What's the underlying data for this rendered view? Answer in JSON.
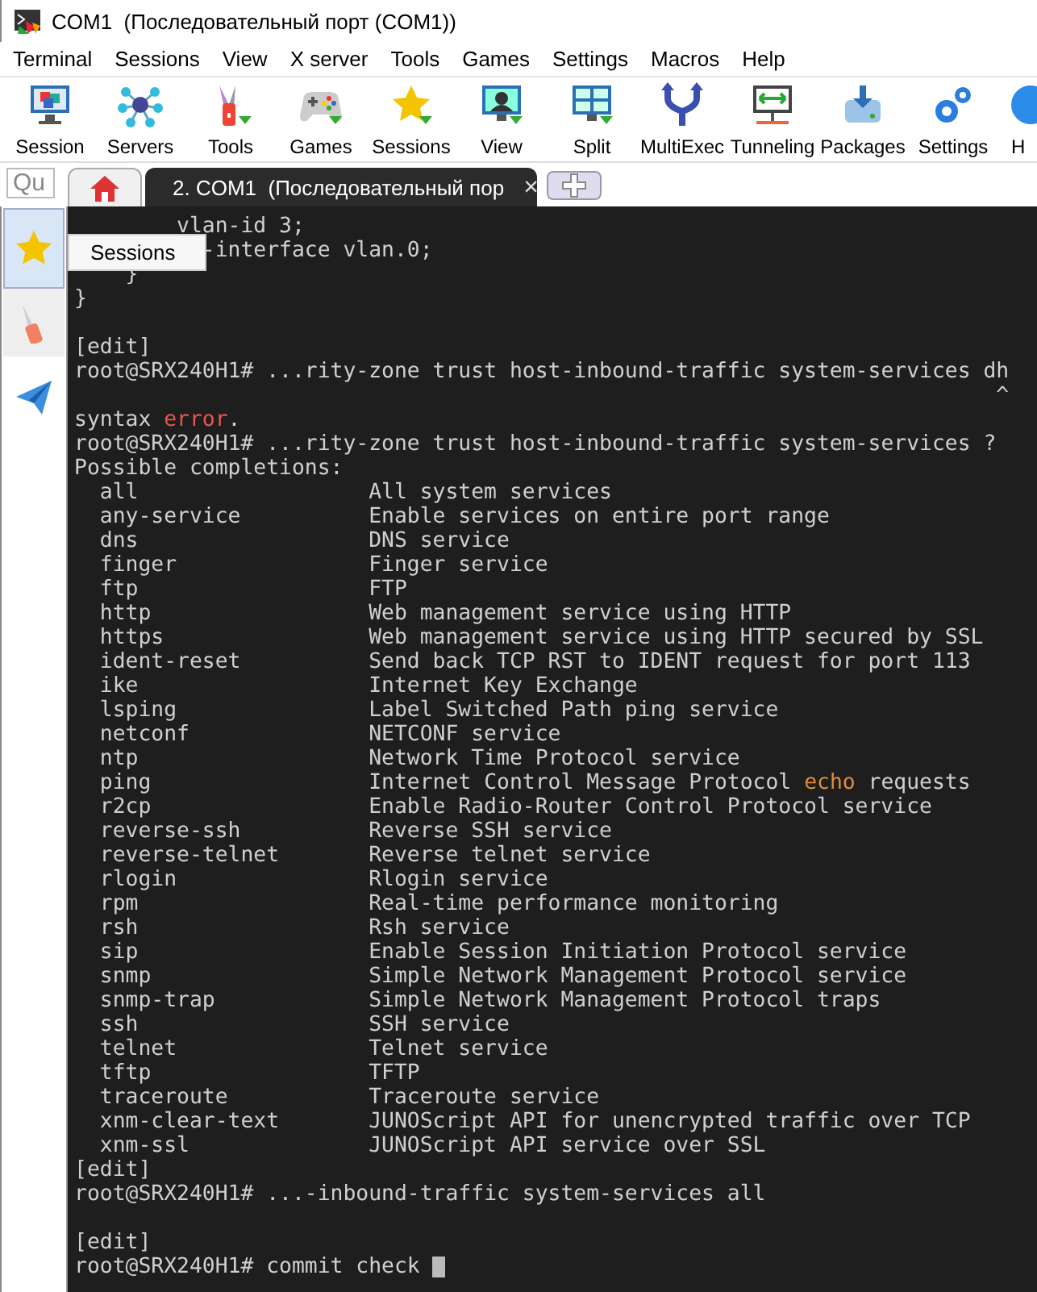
{
  "window": {
    "title": "COM1  (Последовательный порт (COM1))"
  },
  "menu": [
    "Terminal",
    "Sessions",
    "View",
    "X server",
    "Tools",
    "Games",
    "Settings",
    "Macros",
    "Help"
  ],
  "toolbar": [
    {
      "label": "Session"
    },
    {
      "label": "Servers"
    },
    {
      "label": "Tools"
    },
    {
      "label": "Games"
    },
    {
      "label": "Sessions"
    },
    {
      "label": "View"
    },
    {
      "label": "Split"
    },
    {
      "label": "MultiExec"
    },
    {
      "label": "Tunneling"
    },
    {
      "label": "Packages"
    },
    {
      "label": "Settings"
    },
    {
      "label": "H"
    }
  ],
  "quick_connect": {
    "placeholder": "Qu"
  },
  "tabs": [
    {
      "kind": "home",
      "selected": false
    },
    {
      "kind": "session",
      "label": "2. COM1  (Последовательный пор",
      "close": "×",
      "selected": true
    },
    {
      "kind": "new",
      "selected": false
    }
  ],
  "sidebar": [
    {
      "selected": true
    },
    {
      "selected": false
    },
    {
      "selected": false
    }
  ],
  "tooltip": {
    "text": "Sessions"
  },
  "terminal": {
    "lines": [
      {
        "text": "        vlan-id 3;"
      },
      {
        "text": "          -interface vlan.0;"
      },
      {
        "text": "    }"
      },
      {
        "text": "}",
        "blank_after": true
      },
      {
        "text": "[edit]"
      },
      {
        "text": "root@SRX240H1# ...rity-zone trust host-inbound-traffic system-services dh"
      },
      {
        "text": "                                                                        ^"
      },
      {
        "parts": [
          {
            "text": "syntax "
          },
          {
            "text": "error",
            "kind": "error"
          },
          {
            "text": "."
          }
        ]
      },
      {
        "text": "root@SRX240H1# ...rity-zone trust host-inbound-traffic system-services ?"
      },
      {
        "text": "Possible completions:"
      },
      {
        "text": "  all                  All system services"
      },
      {
        "text": "  any-service          Enable services on entire port range"
      },
      {
        "text": "  dns                  DNS service"
      },
      {
        "text": "  finger               Finger service"
      },
      {
        "text": "  ftp                  FTP"
      },
      {
        "text": "  http                 Web management service using HTTP"
      },
      {
        "text": "  https                Web management service using HTTP secured by SSL"
      },
      {
        "text": "  ident-reset          Send back TCP RST to IDENT request for port 113"
      },
      {
        "text": "  ike                  Internet Key Exchange"
      },
      {
        "text": "  lsping               Label Switched Path ping service"
      },
      {
        "text": "  netconf              NETCONF service"
      },
      {
        "text": "  ntp                  Network Time Protocol service"
      },
      {
        "parts": [
          {
            "text": "  ping                 Internet Control Message Protocol "
          },
          {
            "text": "echo",
            "kind": "keyword"
          },
          {
            "text": " requests"
          }
        ]
      },
      {
        "text": "  r2cp                 Enable Radio-Router Control Protocol service"
      },
      {
        "text": "  reverse-ssh          Reverse SSH service"
      },
      {
        "text": "  reverse-telnet       Reverse telnet service"
      },
      {
        "text": "  rlogin               Rlogin service"
      },
      {
        "text": "  rpm                  Real-time performance monitoring"
      },
      {
        "text": "  rsh                  Rsh service"
      },
      {
        "text": "  sip                  Enable Session Initiation Protocol service"
      },
      {
        "text": "  snmp                 Simple Network Management Protocol service"
      },
      {
        "text": "  snmp-trap            Simple Network Management Protocol traps"
      },
      {
        "text": "  ssh                  SSH service"
      },
      {
        "text": "  telnet               Telnet service"
      },
      {
        "text": "  tftp                 TFTP"
      },
      {
        "text": "  traceroute           Traceroute service"
      },
      {
        "text": "  xnm-clear-text       JUNOScript API for unencrypted traffic over TCP"
      },
      {
        "text": "  xnm-ssl              JUNOScript API service over SSL"
      },
      {
        "text": "[edit]"
      },
      {
        "text": "root@SRX240H1# ...-inbound-traffic system-services all",
        "blank_after": true
      },
      {
        "text": "[edit]"
      },
      {
        "text": "root@SRX240H1# commit check ",
        "cursor": true
      }
    ]
  }
}
